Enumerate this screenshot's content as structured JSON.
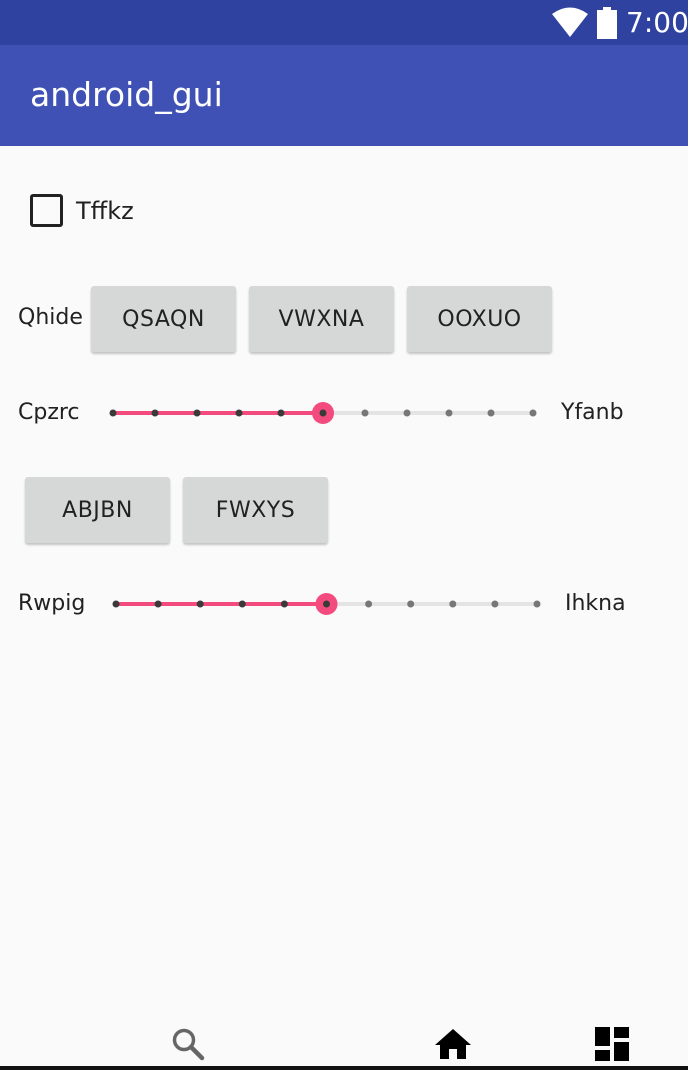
{
  "status_bar": {
    "time": "7:00",
    "icons": [
      "wifi-icon",
      "battery-icon"
    ]
  },
  "app_bar": {
    "title": "android_gui"
  },
  "checkbox": {
    "label": "Tffkz",
    "checked": false
  },
  "row1": {
    "label": "Qhide",
    "buttons": [
      "QSAQN",
      "VWXNA",
      "OOXUO"
    ]
  },
  "slider1": {
    "left_label": "Cpzrc",
    "right_label": "Yfanb",
    "value": 5,
    "max": 10
  },
  "row2": {
    "buttons": [
      "ABJBN",
      "FWXYS"
    ]
  },
  "slider2": {
    "left_label": "Rwpig",
    "right_label": "Ihkna",
    "value": 5,
    "max": 10
  },
  "nav_bar": {
    "icons": [
      "search-icon",
      "home-icon",
      "recents-icon"
    ]
  },
  "colors": {
    "primary": "#3f51b5",
    "primary_dark": "#3042a0",
    "accent": "#f44b7e",
    "button": "#d6d7d7"
  }
}
